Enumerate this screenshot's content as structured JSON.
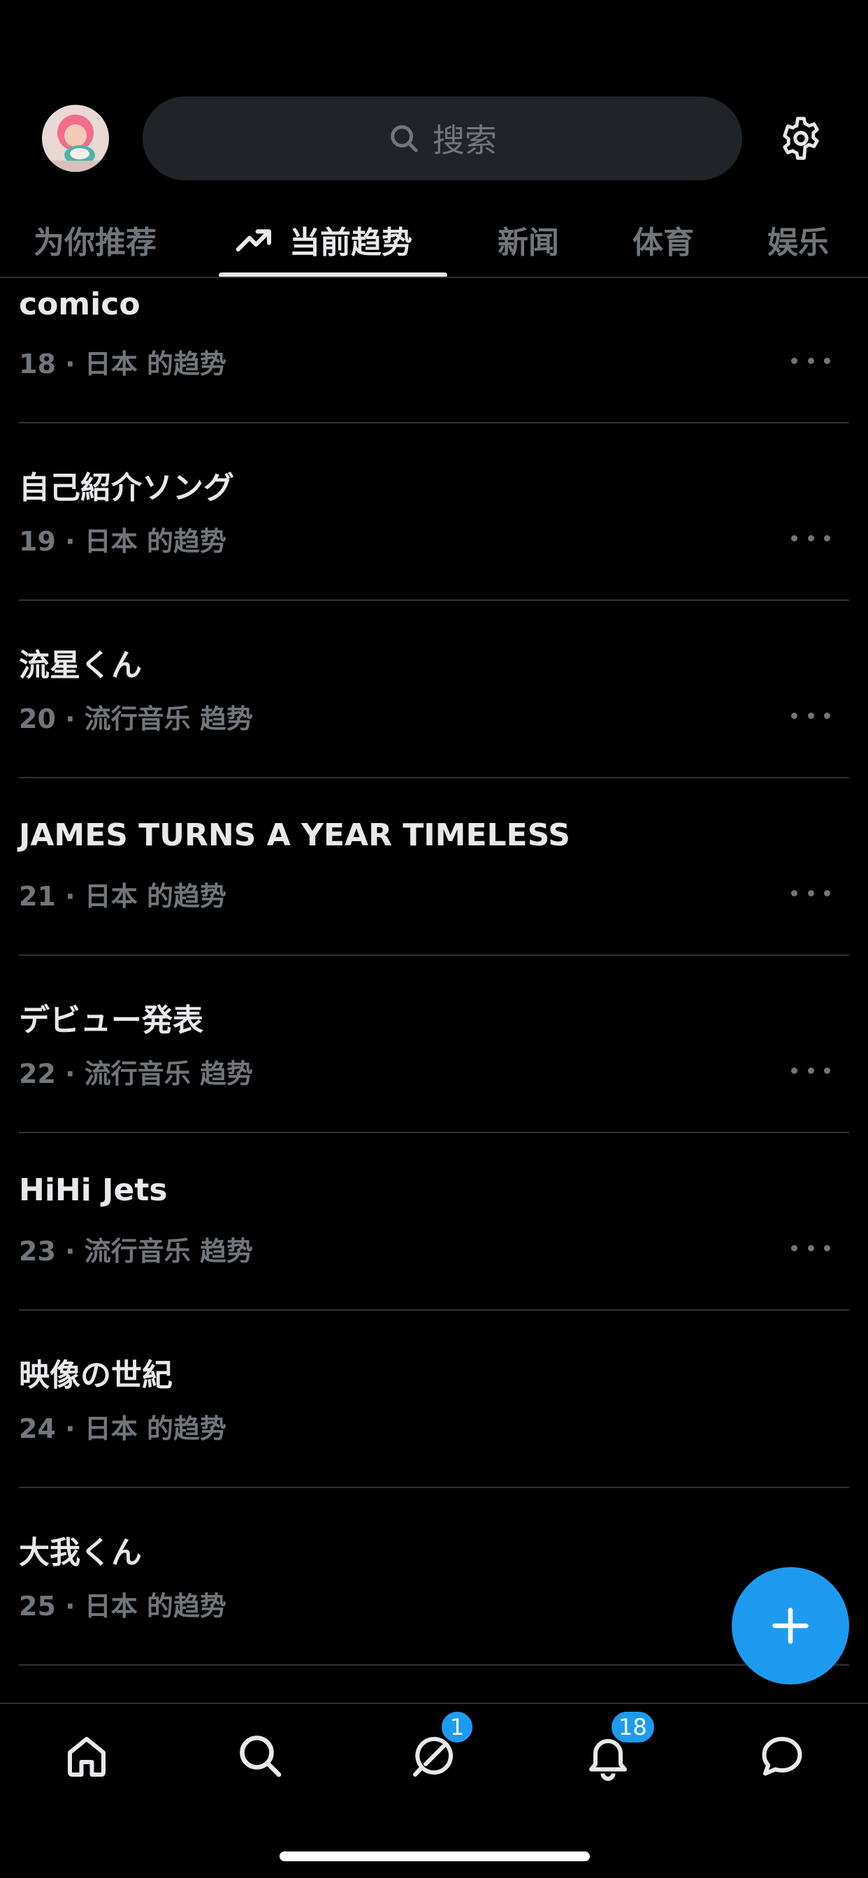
{
  "header": {
    "search_placeholder": "搜索",
    "icons": {
      "avatar": "avatar",
      "search": "search-icon",
      "settings": "gear-icon"
    }
  },
  "tabs": [
    {
      "label": "为你推荐",
      "active": false
    },
    {
      "label": "当前趋势",
      "active": true,
      "icon": "trending-icon"
    },
    {
      "label": "新闻",
      "active": false
    },
    {
      "label": "体育",
      "active": false
    },
    {
      "label": "娱乐",
      "active": false
    }
  ],
  "trends": [
    {
      "title": "comico",
      "meta": "18 · 日本 的趋势"
    },
    {
      "title": "自己紹介ソング",
      "meta": "19 · 日本 的趋势"
    },
    {
      "title": "流星くん",
      "meta": "20 · 流行音乐 趋势"
    },
    {
      "title": "JAMES TURNS A YEAR TIMELESS",
      "meta": "21 · 日本 的趋势"
    },
    {
      "title": "デビュー発表",
      "meta": "22 · 流行音乐 趋势"
    },
    {
      "title": "HiHi Jets",
      "meta": "23 · 流行音乐 趋势"
    },
    {
      "title": "映像の世紀",
      "meta": "24 · 日本 的趋势"
    },
    {
      "title": "大我くん",
      "meta": "25 · 日本 的趋势"
    }
  ],
  "bottom_nav": {
    "items": [
      "home-icon",
      "search-icon",
      "spaces-icon",
      "bell-icon",
      "message-icon"
    ],
    "spaces_badge": "1",
    "notifications_badge": "18"
  },
  "colors": {
    "accent": "#1d9bf0",
    "background": "#000000",
    "secondary_text": "#71767b",
    "divider": "#2f3336"
  }
}
